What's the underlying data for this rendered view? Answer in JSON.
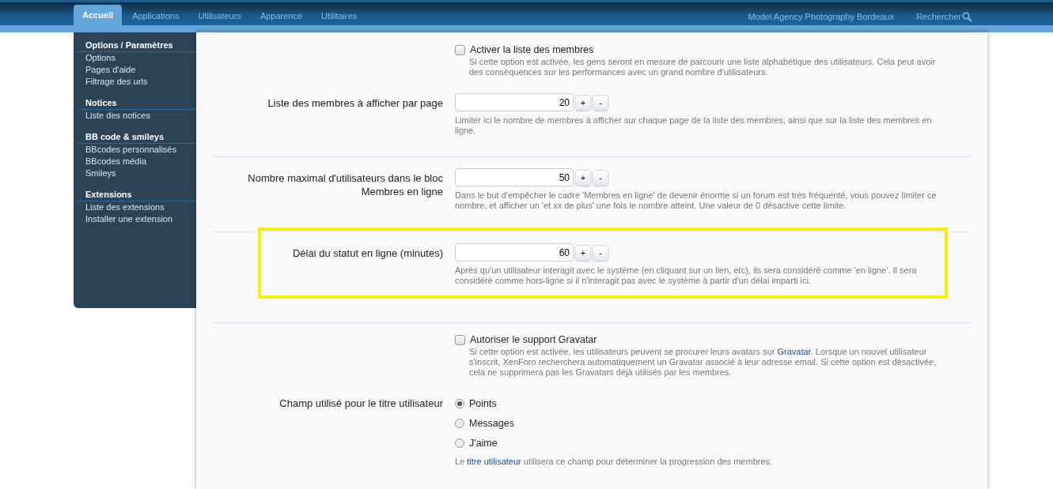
{
  "tabs": [
    {
      "label": "Accueil",
      "selected": true
    },
    {
      "label": "Applications",
      "selected": false
    },
    {
      "label": "Utilisateurs",
      "selected": false
    },
    {
      "label": "Apparence",
      "selected": false
    },
    {
      "label": "Utilitaires",
      "selected": false
    }
  ],
  "site_link": "Model Agency Photography Bordeaux",
  "search_link": "Rechercher",
  "sidebar": {
    "groups": [
      {
        "title": "Options / Paramètres",
        "items": [
          "Options",
          "Pages d'aide",
          "Filtrage des urls"
        ]
      },
      {
        "title": "Notices",
        "items": [
          "Liste des notices"
        ]
      },
      {
        "title": "BB code & smileys",
        "items": [
          "BBcodes personnalisés",
          "BBcodes média",
          "Smileys"
        ]
      },
      {
        "title": "Extensions",
        "items": [
          "Liste des extensions",
          "Installer une extension"
        ]
      }
    ]
  },
  "sections": [
    {
      "highlighted": false,
      "rows": [
        {
          "kind": "checkbox",
          "label": "Activer la liste des membres",
          "checked": false,
          "hint": [
            {
              "text": "Si cette option est activée, les gens seront en mesure de parcourir une liste alphabétique des utilisateurs. Cela peut avoir des conséquences sur les performances avec un grand nombre d'utilisateurs.",
              "link": false
            }
          ]
        },
        {
          "kind": "spinner",
          "label": "Liste des membres à afficher par page",
          "value": "20",
          "plus": "+",
          "minus": "-",
          "hint": [
            {
              "text": "Limiter ici le nombre de membres à afficher sur chaque page de la liste des membres, ainsi que sur la liste des membres en ligne.",
              "link": false
            }
          ]
        }
      ]
    },
    {
      "highlighted": false,
      "rows": [
        {
          "kind": "spinner",
          "label": "Nombre maximal d'utilisateurs dans le bloc Membres en ligne",
          "value": "50",
          "plus": "+",
          "minus": "-",
          "hint": [
            {
              "text": "Dans le but d'empêcher le cadre 'Membres en ligne' de devenir énorme si un forum est très fréquenté, vous pouvez limiter ce nombre, et afficher un 'et xx de plus' une fois le nombre atteint. Une valeur de 0 désactive cette limite.",
              "link": false
            }
          ]
        }
      ]
    },
    {
      "highlighted": true,
      "rows": [
        {
          "kind": "spinner",
          "label": "Délai du statut en ligne (minutes)",
          "value": "60",
          "plus": "+",
          "minus": "-",
          "hint": [
            {
              "text": "Après qu'un utilisateur interagit avec le système (en cliquant sur un lien, etc), ils sera considéré comme 'en ligne'. Il sera considéré comme hors-ligne si il n'interagit pas avec le système à partir d'un délai imparti ici.",
              "link": false
            }
          ]
        }
      ]
    },
    {
      "highlighted": false,
      "rows": [
        {
          "kind": "checkbox",
          "label": "Autoriser le support Gravatar",
          "checked": false,
          "hint": [
            {
              "text": "Si cette option est activée, les utilisateurs peuvent se procurer leurs avatars sur ",
              "link": false
            },
            {
              "text": "Gravatar",
              "link": true
            },
            {
              "text": ". Lorsque un nouvel utilisateur s'inscrit, XenForo recherchera automatiquement un Gravatar associé à leur adresse email. Si cette option est désactivée, cela ne supprimera pas les Gravatars déjà utilisés par les membres.",
              "link": false
            }
          ]
        },
        {
          "kind": "radio",
          "label": "Champ utilisé pour le titre utilisateur",
          "options": [
            {
              "label": "Points",
              "selected": true
            },
            {
              "label": "Messages",
              "selected": false
            },
            {
              "label": "J'aime",
              "selected": false
            }
          ],
          "hint": [
            {
              "text": "Le ",
              "link": false
            },
            {
              "text": "titre utilisateur",
              "link": true
            },
            {
              "text": " utilisera ce champ pour déterminer la progression des membres.",
              "link": false
            }
          ]
        }
      ]
    }
  ]
}
